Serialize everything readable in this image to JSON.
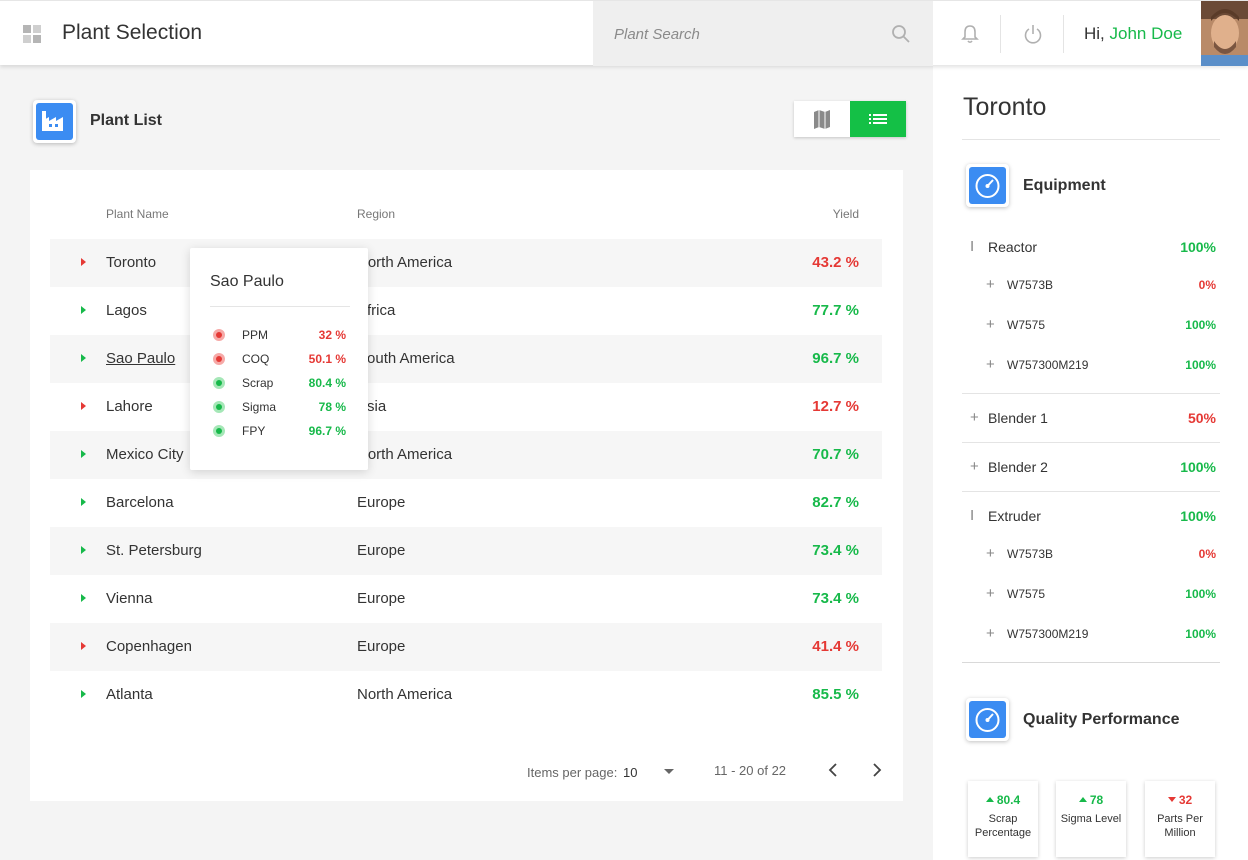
{
  "header": {
    "title": "Plant Selection",
    "search_placeholder": "Plant Search",
    "greeting": "Hi,",
    "user_name": "John Doe"
  },
  "plant_list": {
    "title": "Plant List",
    "columns": {
      "name": "Plant Name",
      "region": "Region",
      "yield": "Yield"
    },
    "rows": [
      {
        "name": "Toronto",
        "region": "North America",
        "yield": "43.2 %",
        "trend": "down"
      },
      {
        "name": "Lagos",
        "region": "Africa",
        "yield": "77.7 %",
        "trend": "up"
      },
      {
        "name": "Sao Paulo",
        "region": "South America",
        "yield": "96.7 %",
        "trend": "up"
      },
      {
        "name": "Lahore",
        "region": "Asia",
        "yield": "12.7 %",
        "trend": "down"
      },
      {
        "name": "Mexico City",
        "region": "North America",
        "yield": "70.7 %",
        "trend": "up"
      },
      {
        "name": "Barcelona",
        "region": "Europe",
        "yield": "82.7 %",
        "trend": "up"
      },
      {
        "name": "St. Petersburg",
        "region": "Europe",
        "yield": "73.4 %",
        "trend": "up"
      },
      {
        "name": "Vienna",
        "region": "Europe",
        "yield": "73.4 %",
        "trend": "up"
      },
      {
        "name": "Copenhagen",
        "region": "Europe",
        "yield": "41.4 %",
        "trend": "down"
      },
      {
        "name": "Atlanta",
        "region": "North America",
        "yield": "85.5 %",
        "trend": "up"
      }
    ],
    "pagination": {
      "items_per_page_label": "Items per page:",
      "items_per_page": "10",
      "range": "11 - 20 of 22"
    }
  },
  "tooltip": {
    "title": "Sao Paulo",
    "metrics": [
      {
        "label": "PPM",
        "value": "32 %",
        "status": "bad"
      },
      {
        "label": "COQ",
        "value": "50.1 %",
        "status": "bad"
      },
      {
        "label": "Scrap",
        "value": "80.4 %",
        "status": "good"
      },
      {
        "label": "Sigma",
        "value": "78 %",
        "status": "good"
      },
      {
        "label": "FPY",
        "value": "96.7 %",
        "status": "good"
      }
    ]
  },
  "detail": {
    "city": "Toronto",
    "equipment_title": "Equipment",
    "equipment": [
      {
        "label": "Reactor",
        "value": "100%",
        "status": "good",
        "level": 0,
        "expanded": true
      },
      {
        "label": "W7573B",
        "value": "0%",
        "status": "bad",
        "level": 1
      },
      {
        "label": "W7575",
        "value": "100%",
        "status": "good",
        "level": 1
      },
      {
        "label": "W757300M219",
        "value": "100%",
        "status": "good",
        "level": 1
      },
      {
        "label": "Blender 1",
        "value": "50%",
        "status": "bad",
        "level": 0,
        "expanded": false
      },
      {
        "label": "Blender 2",
        "value": "100%",
        "status": "good",
        "level": 0,
        "expanded": false
      },
      {
        "label": "Extruder",
        "value": "100%",
        "status": "good",
        "level": 0,
        "expanded": true
      },
      {
        "label": "W7573B",
        "value": "0%",
        "status": "bad",
        "level": 1
      },
      {
        "label": "W7575",
        "value": "100%",
        "status": "good",
        "level": 1
      },
      {
        "label": "W757300M219",
        "value": "100%",
        "status": "good",
        "level": 1
      }
    ],
    "quality_title": "Quality Performance",
    "kpis": [
      {
        "value": "80.4",
        "label": "Scrap Percentage",
        "trend": "up"
      },
      {
        "value": "78",
        "label": "Sigma Level",
        "trend": "up"
      },
      {
        "value": "32",
        "label": "Parts Per Million",
        "trend": "down"
      }
    ]
  },
  "colors": {
    "accent_green": "#17b94a",
    "alert_red": "#e53935",
    "icon_blue": "#3b8cf2"
  }
}
